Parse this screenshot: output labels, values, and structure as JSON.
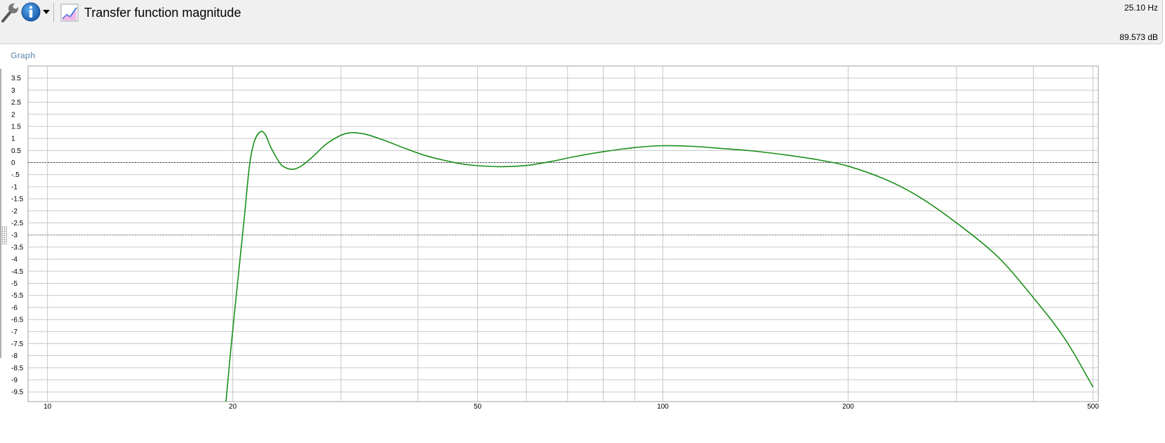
{
  "toolbar": {
    "title": "Transfer function magnitude",
    "cursor_frequency": "25.10 Hz",
    "cursor_level": "89.573 dB",
    "icons": [
      "wrench-icon",
      "info-icon",
      "dropdown-arrow-icon",
      "graph-icon"
    ]
  },
  "panel": {
    "label": "Graph"
  },
  "colors": {
    "curve": "#1a8f1a",
    "grid": "#c8c8c8",
    "reference": "#444444"
  },
  "chart_data": {
    "type": "line",
    "title": "Transfer function magnitude",
    "xscale": "log",
    "xlim": [
      9.3,
      510
    ],
    "ylim": [
      -9.9,
      4.0
    ],
    "x_ticks": [
      10,
      20,
      50,
      100,
      200,
      500
    ],
    "x_tick_labels": [
      "10",
      "20",
      "50",
      "100",
      "200",
      "500"
    ],
    "y_ticks": [
      3.5,
      3,
      2.5,
      2,
      1.5,
      1,
      0.5,
      0,
      -0.5,
      -1,
      -1.5,
      -2,
      -2.5,
      -3,
      -3.5,
      -4,
      -4.5,
      -5,
      -5.5,
      -6,
      -6.5,
      -7,
      -7.5,
      -8,
      -8.5,
      -9,
      -9.5
    ],
    "y_tick_labels": [
      "3.5",
      "3",
      "2.5",
      "2",
      "1.5",
      "1",
      "0.5",
      "0",
      "-.5",
      "-1",
      "-1.5",
      "-2",
      "-2.5",
      "-3",
      "-3.5",
      "-4",
      "-4.5",
      "-5",
      "-5.5",
      "-6",
      "-6.5",
      "-7",
      "-7.5",
      "-8",
      "-8.5",
      "-9",
      "-9.5"
    ],
    "reference_lines": [
      0,
      -3
    ],
    "grid": true,
    "series": [
      {
        "x": [
          19.5,
          19.9,
          20.4,
          20.9,
          21.3,
          21.7,
          22.2,
          22.6,
          23.0,
          23.5,
          24.0,
          24.6,
          25.2,
          26.0,
          27.0,
          28.5,
          30.5,
          32.5,
          35.0,
          38.0,
          41.0,
          44.0,
          47.0,
          50.0,
          55.0,
          60.0,
          66.0,
          72.0,
          80.0,
          90.0,
          100.0,
          112.0,
          125.0,
          140.0,
          160.0,
          180.0,
          200.0,
          230.0,
          260.0,
          300.0,
          350.0,
          400.0,
          450.0,
          500.0
        ],
        "y": [
          -9.9,
          -7.5,
          -4.8,
          -2.2,
          -0.1,
          0.9,
          1.28,
          1.15,
          0.7,
          0.25,
          -0.1,
          -0.25,
          -0.27,
          -0.1,
          0.25,
          0.8,
          1.2,
          1.2,
          0.95,
          0.6,
          0.3,
          0.1,
          -0.05,
          -0.13,
          -0.17,
          -0.12,
          0.05,
          0.25,
          0.45,
          0.62,
          0.7,
          0.67,
          0.58,
          0.48,
          0.3,
          0.1,
          -0.15,
          -0.7,
          -1.4,
          -2.5,
          -3.9,
          -5.6,
          -7.3,
          -9.3
        ]
      }
    ]
  }
}
